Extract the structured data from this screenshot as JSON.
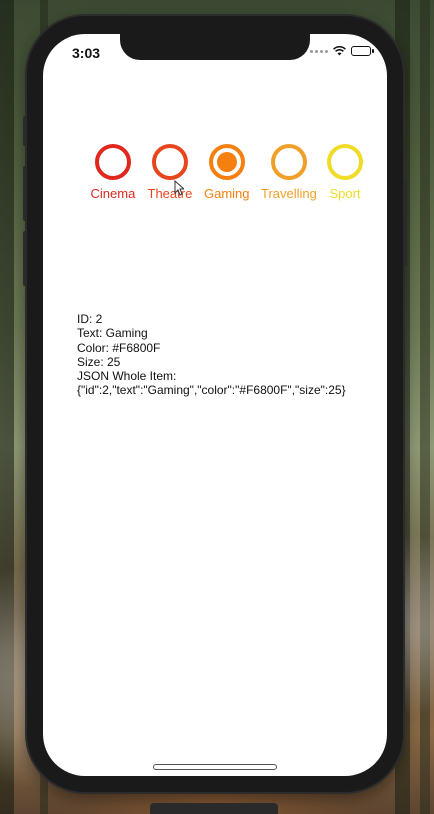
{
  "status_bar": {
    "time": "3:03"
  },
  "selector": {
    "items": [
      {
        "id": 0,
        "label": "Cinema",
        "color": "#E0281E",
        "selected": false
      },
      {
        "id": 1,
        "label": "Theatre",
        "color": "#E8461E",
        "selected": false
      },
      {
        "id": 2,
        "label": "Gaming",
        "color": "#F6800F",
        "selected": true
      },
      {
        "id": 3,
        "label": "Travelling",
        "color": "#F0A028",
        "selected": false
      },
      {
        "id": 4,
        "label": "Sport",
        "color": "#F0DC28",
        "selected": false
      }
    ]
  },
  "info": {
    "id_line": "ID: 2",
    "text_line": "Text: Gaming",
    "color_line": "Color: #F6800F",
    "size_line": "Size: 25",
    "json_heading": "JSON Whole Item:",
    "json_value": "{\"id\":2,\"text\":\"Gaming\",\"color\":\"#F6800F\",\"size\":25}"
  },
  "icons": {
    "wifi": "wifi-icon",
    "battery": "battery-icon",
    "signal": "signal-icon",
    "cursor": "mouse-pointer-icon"
  }
}
